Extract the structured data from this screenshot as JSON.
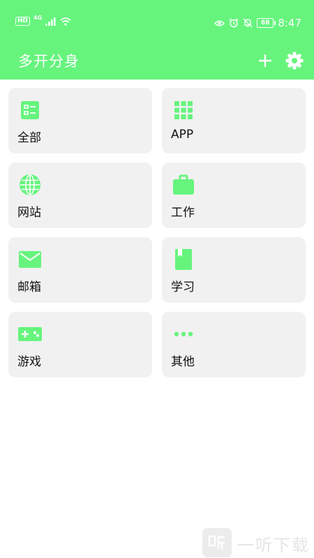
{
  "status_bar": {
    "hd": "HD",
    "network": "4G",
    "battery": "68",
    "time": "8:47",
    "icons": [
      "signal-icon",
      "wifi-icon",
      "eye-icon",
      "alarm-icon",
      "mute-icon"
    ]
  },
  "app_bar": {
    "title": "多开分身",
    "add_icon": "plus-icon",
    "settings_icon": "gear-icon"
  },
  "categories": [
    {
      "label": "全部",
      "icon": "list-icon"
    },
    {
      "label": "APP",
      "icon": "apps-grid-icon"
    },
    {
      "label": "网站",
      "icon": "globe-icon"
    },
    {
      "label": "工作",
      "icon": "briefcase-icon"
    },
    {
      "label": "邮箱",
      "icon": "mail-icon"
    },
    {
      "label": "学习",
      "icon": "book-icon"
    },
    {
      "label": "游戏",
      "icon": "gamepad-icon"
    },
    {
      "label": "其他",
      "icon": "more-icon"
    }
  ],
  "watermark": {
    "text": "一听下载"
  },
  "colors": {
    "accent": "#66f47d",
    "card_bg": "#f1f1f1",
    "text": "#111111"
  }
}
